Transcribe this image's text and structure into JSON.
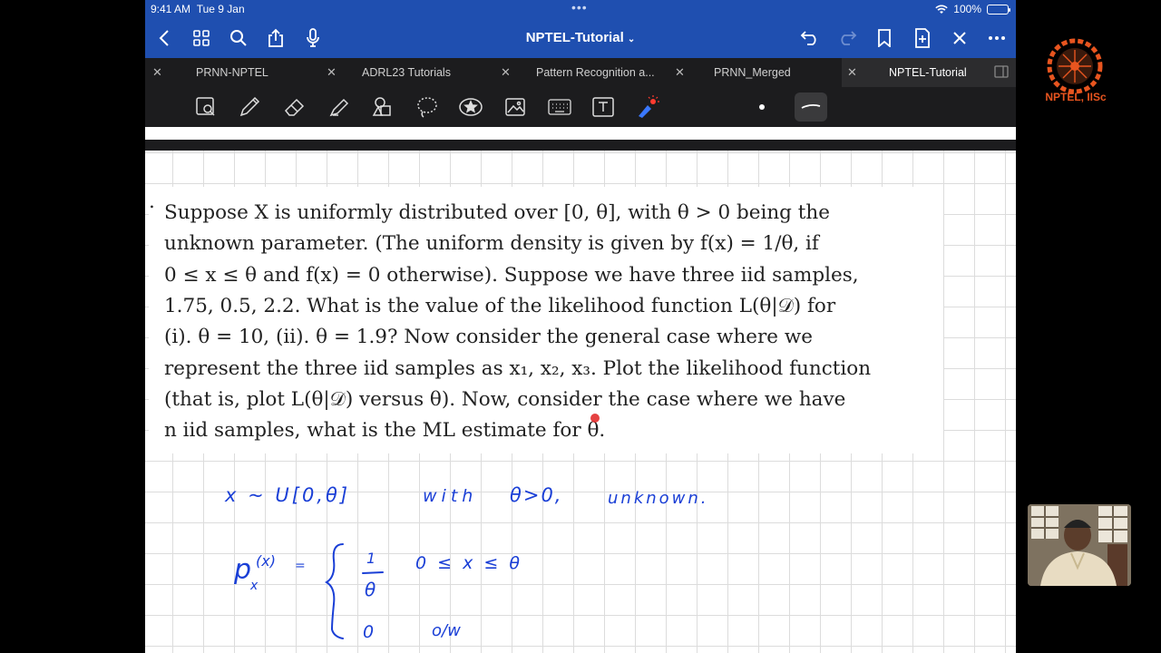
{
  "status_bar": {
    "time": "9:41 AM",
    "date": "Tue 9 Jan",
    "battery": "100%"
  },
  "nav": {
    "title": "NPTEL-Tutorial"
  },
  "tabs": [
    {
      "label": "PRNN-NPTEL"
    },
    {
      "label": "ADRL23 Tutorials"
    },
    {
      "label": "Pattern Recognition a..."
    },
    {
      "label": "PRNN_Merged"
    },
    {
      "label": "NPTEL-Tutorial"
    }
  ],
  "problem": {
    "bullet": ".",
    "lines": [
      "Suppose X is uniformly distributed over [0, θ], with θ > 0 being the",
      "unknown parameter. (The uniform density is given by f(x) = 1/θ, if",
      "0 ≤ x ≤ θ and f(x) = 0 otherwise). Suppose we have three iid samples,",
      "1.75, 0.5, 2.2. What is the value of the likelihood function L(θ|𝒟) for",
      "(i). θ = 10, (ii). θ = 1.9? Now consider the general case where we",
      "represent the three iid samples as x₁, x₂, x₃. Plot the likelihood function",
      "(that is, plot L(θ|𝒟) versus θ). Now, consider the case where we have",
      "n iid samples, what is the ML estimate for θ."
    ]
  },
  "handwriting": {
    "line1": {
      "a": "x ~ U[0,θ]",
      "b": "with",
      "c": "θ>0,",
      "d": "unknown."
    },
    "density": {
      "lhs": "p",
      "lhs_sup": "(x)",
      "lhs_sub": "x",
      "eq": "=",
      "one": "1",
      "theta": "θ",
      "cond1": "0 ≤ x ≤ θ",
      "zero": "0",
      "cond2": "o/w"
    }
  },
  "branding": {
    "logo_text": "NPTEL, IISc"
  },
  "colors": {
    "nav_blue": "#1f4fb0",
    "ink_blue": "#1a3fd6",
    "brand_orange": "#e8551f"
  }
}
